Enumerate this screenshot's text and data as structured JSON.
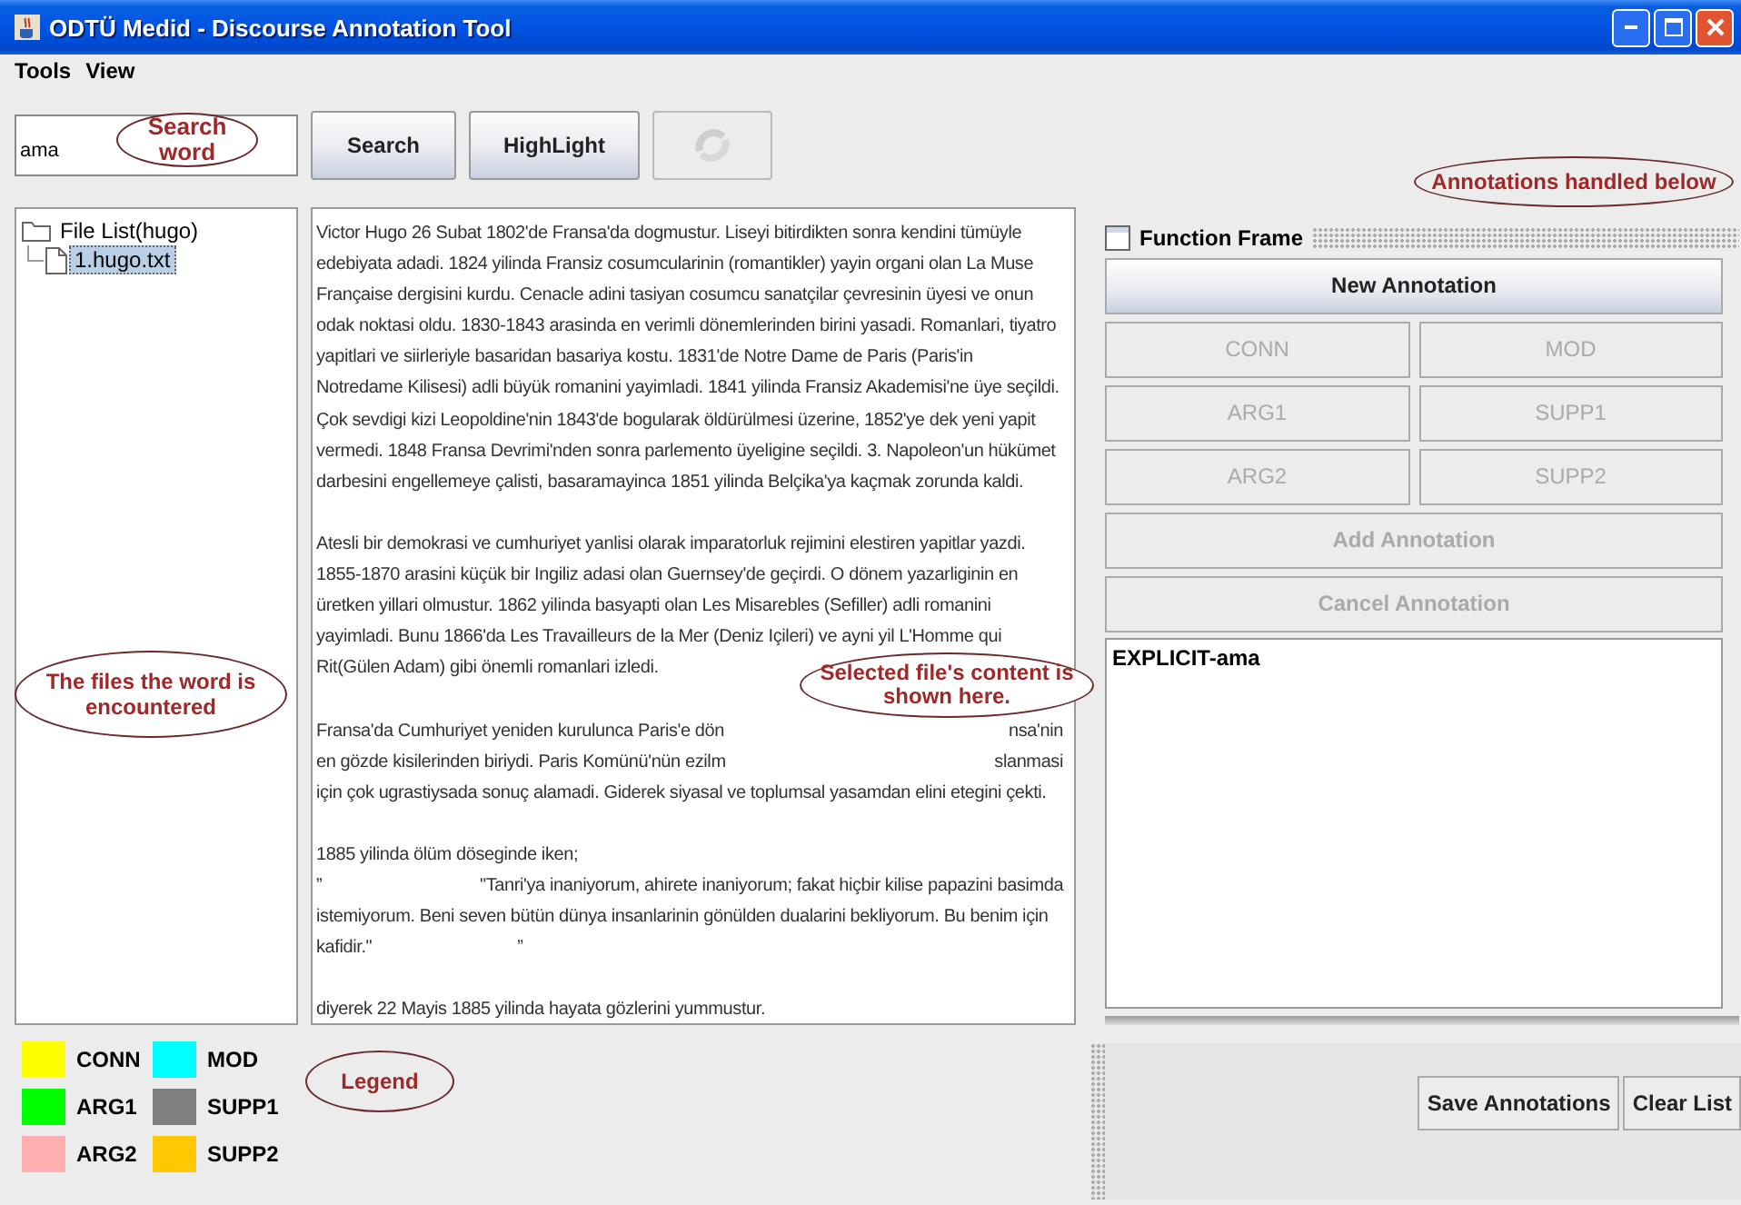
{
  "window": {
    "title": "ODTÜ Medid - Discourse Annotation Tool"
  },
  "menu": [
    "Tools",
    "View"
  ],
  "search": {
    "value": "ama"
  },
  "toolbar": [
    {
      "kind": "text",
      "label": "Search",
      "disabled": false
    },
    {
      "kind": "text",
      "label": "HighLight",
      "disabled": false
    },
    {
      "kind": "icon",
      "disabled": true
    }
  ],
  "file_tree": {
    "label": "File List(hugo)",
    "expanded": true,
    "children": [
      {
        "label": "1.hugo.txt",
        "selected": true
      }
    ]
  },
  "document": {
    "lines": [
      {
        "kind": "line",
        "parts": [
          "Victor Hugo 26 Subat 1802'de Fransa'da dogmustur. Liseyi bitirdikten sonra kendini tümüyle"
        ]
      },
      {
        "kind": "line",
        "parts": [
          "edebiyata adadi. 1824 yilinda Fransiz cosumcularinin (romantikler) yayin organi olan La Muse"
        ]
      },
      {
        "kind": "line",
        "parts": [
          "Française dergisini kurdu. Cenacle adini tasiyan cosumcu sanatçilar çevresinin üyesi ve onun"
        ]
      },
      {
        "kind": "line",
        "parts": [
          "odak noktasi oldu. 1830-1843 arasinda en verimli dönemlerinden birini yasadi. Romanlari, tiyatro"
        ]
      },
      {
        "kind": "line",
        "parts": [
          "yapitlari ve siirleriyle basaridan basariya kostu. 1831'de Notre Dame de Paris (Paris'in"
        ]
      },
      {
        "kind": "line",
        "parts": [
          "Notredame Kilisesi) adli büyük romanini yayimladi. 1841 yilinda Fransiz Akademisi'ne üye seçildi."
        ]
      },
      {
        "kind": "line",
        "parts": [
          "Çok sevdigi kizi Leopoldine'nin 1843'de bogularak öldürülmesi üzerine, 1852'ye dek yeni yapit"
        ]
      },
      {
        "kind": "line",
        "parts": [
          "vermedi. 1848 Fransa Devrimi'nden sonra parlemento üyeligine seçildi. 3. Napoleon'un hükümet"
        ]
      },
      {
        "kind": "line",
        "parts": [
          "darbesini engellemeye çalisti, basaramayinca 1851 yilinda Belçika'ya kaçmak zorunda kaldi."
        ]
      },
      {
        "kind": "blank"
      },
      {
        "kind": "line",
        "parts": [
          "Atesli bir demokrasi ve cumhuriyet yanlisi olarak imparatorluk rejimini elestiren yapitlar yazdi."
        ]
      },
      {
        "kind": "line",
        "parts": [
          "1855-1870 arasini küçük bir Ingiliz adasi olan Guernsey'de geçirdi. O dönem yazarliginin en"
        ]
      },
      {
        "kind": "line",
        "parts": [
          "üretken yillari olmustur. 1862 yilinda basyapti olan Les Misarebles (Sefiller) adli romanini"
        ]
      },
      {
        "kind": "line",
        "parts": [
          "yayimladi. Bunu 1866'da Les Travailleurs de la Mer (Deniz Içileri) ve ayni yil L'Homme qui"
        ]
      },
      {
        "kind": "line",
        "parts": [
          "Rit(Gülen Adam) gibi önemli romanlari izledi."
        ]
      },
      {
        "kind": "blank"
      },
      {
        "kind": "spread",
        "parts": [
          "Fransa'da Cumhuriyet yeniden kurulunca Paris'e dön",
          "nsa'nin"
        ]
      },
      {
        "kind": "spread",
        "parts": [
          "en gözde kisilerinden biriydi. Paris Komünü'nün ezilm",
          "slanmasi"
        ]
      },
      {
        "kind": "line",
        "parts": [
          "için çok ugrastiysada sonuç alamadi. Giderek siyasal ve toplumsal yasamdan elini etegini çekti."
        ]
      },
      {
        "kind": "blank"
      },
      {
        "kind": "line",
        "parts": [
          "1885 yilinda ölüm döseginde iken;"
        ]
      },
      {
        "kind": "tab",
        "parts": [
          "”",
          "\"Tanri'ya inaniyorum, ahirete inaniyorum; fakat hiçbir kilise papazini basimda"
        ]
      },
      {
        "kind": "line",
        "parts": [
          "istemiyorum. Beni seven bütün dünya insanlarinin gönülden dualarini bekliyorum. Bu benim için"
        ]
      },
      {
        "kind": "tab",
        "parts": [
          "kafidir.\"",
          "”"
        ]
      },
      {
        "kind": "blank"
      },
      {
        "kind": "line",
        "parts": [
          "diyerek 22 Mayis 1885 yilinda hayata gözlerini yummustur."
        ]
      }
    ]
  },
  "function_frame": {
    "title": "Function Frame",
    "buttons": [
      {
        "kind": "wide",
        "label": "New Annotation",
        "disabled": false
      },
      {
        "kind": "half",
        "label": "CONN",
        "disabled": true
      },
      {
        "kind": "half",
        "label": "MOD",
        "disabled": true
      },
      {
        "kind": "half",
        "label": "ARG1",
        "disabled": true
      },
      {
        "kind": "half",
        "label": "SUPP1",
        "disabled": true
      },
      {
        "kind": "half",
        "label": "ARG2",
        "disabled": true
      },
      {
        "kind": "half",
        "label": "SUPP2",
        "disabled": true
      },
      {
        "kind": "wide",
        "label": "Add Annotation",
        "disabled": true
      },
      {
        "kind": "wide",
        "label": "Cancel Annotation",
        "disabled": true
      }
    ],
    "annotations": [
      "EXPLICIT-ama"
    ]
  },
  "bottom_buttons": [
    "Save Annotations",
    "Clear List"
  ],
  "legend": [
    {
      "label": "CONN",
      "color": "#ffff00"
    },
    {
      "label": "MOD",
      "color": "#00ffff"
    },
    {
      "label": "ARG1",
      "color": "#00ff00"
    },
    {
      "label": "SUPP1",
      "color": "#808080"
    },
    {
      "label": "ARG2",
      "color": "#ffafaf"
    },
    {
      "label": "SUPP2",
      "color": "#ffc800"
    }
  ],
  "callouts": [
    "Search word",
    "Annotations handled below",
    "The files the word is encountered",
    "Selected file's content is shown here.",
    "Legend"
  ]
}
